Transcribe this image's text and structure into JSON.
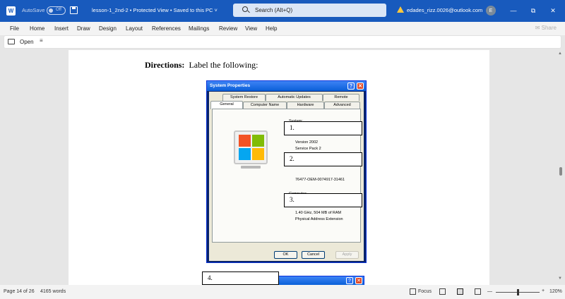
{
  "titlebar": {
    "app_icon": "W",
    "autosave_label": "AutoSave",
    "autosave_state": "Off",
    "doc_title": "lesson-1_2nd-2  •  Protected View  •  Saved to this PC  ˅",
    "search_placeholder": "Search (Alt+Q)",
    "user_email": "edades_rizz.0026@outlook.com",
    "avatar_initial": "E",
    "minimize": "—",
    "restore": "⧉",
    "close": "✕"
  },
  "menu": {
    "items": [
      "File",
      "Home",
      "Insert",
      "Draw",
      "Design",
      "Layout",
      "References",
      "Mailings",
      "Review",
      "View",
      "Help"
    ],
    "share": "Share"
  },
  "toolbar": {
    "open_label": "Open",
    "more": "≡"
  },
  "document": {
    "directions_label": "Directions:",
    "directions_text": "Label the following:",
    "dialog": {
      "title": "System Properties",
      "help": "?",
      "close": "✕",
      "tabs_row1": [
        "System Restore",
        "Automatic Updates",
        "Remote"
      ],
      "tabs_row2": [
        "General",
        "Computer Name",
        "Hardware",
        "Advanced"
      ],
      "system_label": "System:",
      "version": "Version 2002",
      "service_pack": "Service Pack 2",
      "product_id": "76477-OEM-0074917-31461",
      "computer_label": "Computer:",
      "cpu_line": "1.40 GHz, 504 MB of RAM",
      "pae": "Physical Address Extension",
      "ok": "OK",
      "cancel": "Cancel",
      "apply": "Apply"
    },
    "labels": [
      "1.",
      "2.",
      "3.",
      "4."
    ]
  },
  "statusbar": {
    "page": "Page 14 of 26",
    "words": "4165 words",
    "focus": "Focus",
    "zoom_minus": "—",
    "zoom_plus": "+",
    "zoom": "120%"
  },
  "colors": {
    "word_blue": "#185abd",
    "xp_title_blue": "#0a5fd8",
    "xp_face": "#ece9d8"
  }
}
